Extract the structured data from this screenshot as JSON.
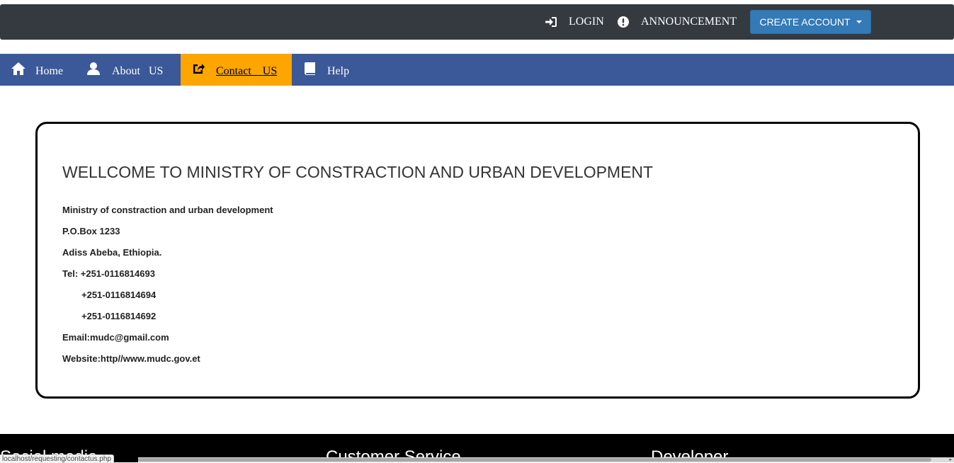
{
  "topbar": {
    "login": {
      "label": "LOGIN",
      "icon": "sign-in-icon"
    },
    "announcement": {
      "label": "ANNOUNCEMENT",
      "icon": "exclamation-circle-icon"
    },
    "create_account": {
      "label": "CREATE ACCOUNT",
      "icon": "caret-down-icon"
    }
  },
  "nav": {
    "items": [
      {
        "label": "Home",
        "icon": "home-icon"
      },
      {
        "label": "About   US",
        "icon": "user-icon"
      },
      {
        "label": "Contact    US",
        "icon": "share-square-icon",
        "active": true
      },
      {
        "label": "Help",
        "icon": "book-icon"
      }
    ]
  },
  "contact": {
    "heading": "WELLCOME TO MINISTRY OF CONSTRACTION AND URBAN DEVELOPMENT",
    "lines": [
      "Ministry of constraction and urban development",
      "P.O.Box 1233",
      "Adiss Abeba, Ethiopia.",
      "Tel: +251-0116814693",
      "+251-0116814694",
      "+251-0116814692",
      "Email:mudc@gmail.com",
      "Website:http//www.mudc.gov.et"
    ]
  },
  "footer": {
    "headings": [
      "Social media",
      "Customer Service",
      "Developer"
    ]
  },
  "status_bar": {
    "url": "localhost/requesting/contactus.php"
  },
  "colors": {
    "topbar": "#343a40",
    "navbar": "#3b5998",
    "active_tab": "#ffa500",
    "button": "#337ab7",
    "footer": "#000000"
  }
}
